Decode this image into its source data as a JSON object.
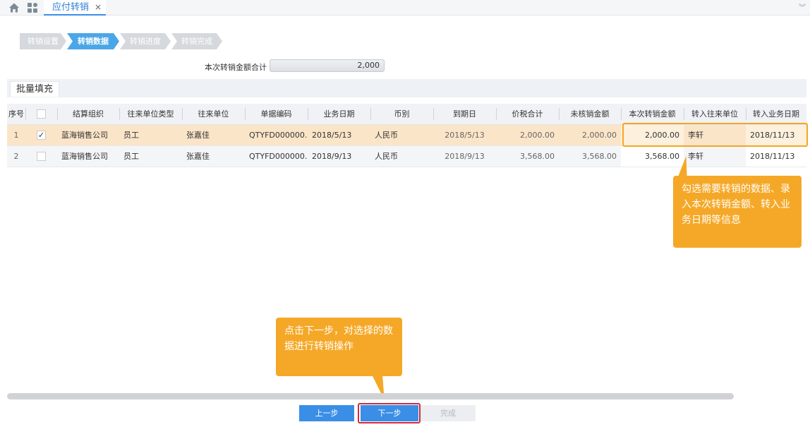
{
  "tab": {
    "title": "应付转销",
    "close": "×"
  },
  "icons": {
    "home": "home-icon",
    "apps": "apps-icon",
    "collapse": "double-chevron-down-icon"
  },
  "steps": [
    "转销设置",
    "转销数据",
    "转销进度",
    "转销完成"
  ],
  "total": {
    "label": "本次转销金额合计",
    "value": "2,000"
  },
  "batch_fill": "批量填充",
  "table": {
    "columns": [
      "序号",
      "",
      "结算组织",
      "往来单位类型",
      "往来单位",
      "单据编码",
      "业务日期",
      "币别",
      "到期日",
      "价税合计",
      "未核销金额",
      "本次转销金额",
      "转入往来单位",
      "转入业务日期"
    ],
    "rows": [
      {
        "seq": "1",
        "checked": "✓",
        "org": "蓝海销售公司",
        "unit_type": "员工",
        "unit": "张嘉佳",
        "code": "QTYFD000000...",
        "biz_date": "2018/5/13",
        "currency": "人民币",
        "due_date": "2018/5/13",
        "total": "2,000.00",
        "unverified": "2,000.00",
        "amount": "2,000.00",
        "to_unit": "李轩",
        "to_date": "2018/11/13"
      },
      {
        "seq": "2",
        "checked": "",
        "org": "蓝海销售公司",
        "unit_type": "员工",
        "unit": "张嘉佳",
        "code": "QTYFD000000...",
        "biz_date": "2018/9/13",
        "currency": "人民币",
        "due_date": "2018/9/13",
        "total": "3,568.00",
        "unverified": "3,568.00",
        "amount": "3,568.00",
        "to_unit": "李轩",
        "to_date": "2018/11/13"
      }
    ]
  },
  "callouts": {
    "select": "勾选需要转销的数据、录入本次转销金额、转入业务日期等信息",
    "next": "点击下一步，对选择的数据进行转销操作"
  },
  "buttons": {
    "prev": "上一步",
    "next": "下一步",
    "finish": "完成"
  },
  "colors": {
    "accent": "#3a8ee6",
    "highlight": "#f5a623",
    "selected_row": "#fbe5c8",
    "outline_red": "#d42a3c"
  }
}
